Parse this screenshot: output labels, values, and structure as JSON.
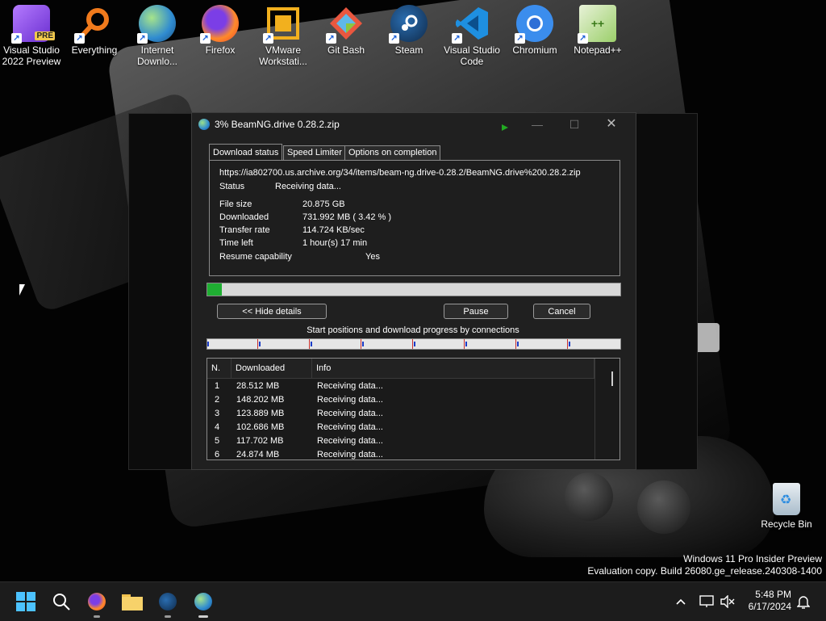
{
  "desktop": {
    "icons": [
      {
        "label": "Visual Studio 2022 Preview",
        "badge": "PRE",
        "icon": "visual-studio-icon"
      },
      {
        "label": "Everything",
        "icon": "everything-search-icon"
      },
      {
        "label": "Internet Downlo...",
        "icon": "internet-download-manager-icon"
      },
      {
        "label": "Firefox",
        "icon": "firefox-icon"
      },
      {
        "label": "VMware Workstati...",
        "icon": "vmware-icon"
      },
      {
        "label": "Git Bash",
        "icon": "git-bash-icon"
      },
      {
        "label": "Steam",
        "icon": "steam-icon"
      },
      {
        "label": "Visual Studio Code",
        "icon": "vscode-icon"
      },
      {
        "label": "Chromium",
        "icon": "chromium-icon"
      },
      {
        "label": "Notepad++",
        "icon": "notepad-plus-plus-icon"
      }
    ],
    "recycle_bin": "Recycle Bin",
    "watermark": {
      "line1": "Windows 11 Pro Insider Preview",
      "line2": "Evaluation copy. Build 26080.ge_release.240308-1400"
    }
  },
  "dialog": {
    "title": "3% BeamNG.drive 0.28.2.zip",
    "tabs": [
      "Download status",
      "Speed Limiter",
      "Options on completion"
    ],
    "url": "https://ia802700.us.archive.org/34/items/beam-ng.drive-0.28.2/BeamNG.drive%200.28.2.zip",
    "status_label": "Status",
    "status_value": "Receiving data...",
    "fields": [
      {
        "label": "File size",
        "value": "20.875  GB"
      },
      {
        "label": "Downloaded",
        "value": "731.992  MB  ( 3.42 % )"
      },
      {
        "label": "Transfer rate",
        "value": "114.724  KB/sec"
      },
      {
        "label": "Time left",
        "value": "1 hour(s) 17 min"
      }
    ],
    "resume_label": "Resume capability",
    "resume_value": "Yes",
    "progress_fraction": 0.0342,
    "buttons": {
      "hide_details": "<< Hide details",
      "pause": "Pause",
      "cancel": "Cancel"
    },
    "connections_caption": "Start positions and download progress by connections",
    "connection_count": 8,
    "table": {
      "headers": [
        "N.",
        "Downloaded",
        "Info"
      ],
      "rows": [
        {
          "n": "1",
          "downloaded": "28.512  MB",
          "info": "Receiving data..."
        },
        {
          "n": "2",
          "downloaded": "148.202  MB",
          "info": "Receiving data..."
        },
        {
          "n": "3",
          "downloaded": "123.889  MB",
          "info": "Receiving data..."
        },
        {
          "n": "4",
          "downloaded": "102.686  MB",
          "info": "Receiving data..."
        },
        {
          "n": "5",
          "downloaded": "117.702  MB",
          "info": "Receiving data..."
        },
        {
          "n": "6",
          "downloaded": "24.874  MB",
          "info": "Receiving data..."
        }
      ]
    }
  },
  "taskbar": {
    "apps": [
      "start-icon",
      "search-icon",
      "firefox-icon",
      "file-explorer-icon",
      "steam-icon",
      "internet-download-manager-icon"
    ],
    "time": "5:48 PM",
    "date": "6/17/2024"
  },
  "colors": {
    "progress_fill": "#1fae32",
    "accent": "#2f8bd1"
  }
}
